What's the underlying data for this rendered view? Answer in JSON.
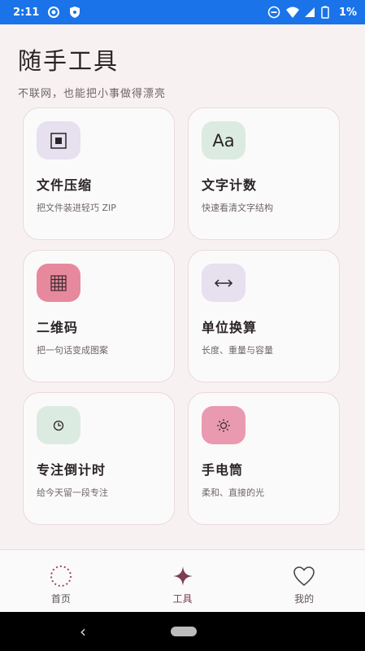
{
  "status_bar": {
    "time": "2:11",
    "battery": "1%"
  },
  "header": {
    "title": "随手工具",
    "subtitle": "不联网，也能把小事做得漂亮"
  },
  "tools": [
    {
      "title": "文件压缩",
      "desc": "把文件装进轻巧 ZIP",
      "icon": "compress-icon",
      "icon_bg": "#e6e0ef",
      "icon_glyph": "▣"
    },
    {
      "title": "文字计数",
      "desc": "快速看清文字结构",
      "icon": "text-icon",
      "icon_bg": "#dcebe2",
      "icon_glyph": "Aa"
    },
    {
      "title": "二维码",
      "desc": "把一句话变成图案",
      "icon": "grid-icon",
      "icon_bg": "#e7899d",
      "icon_glyph": "▦"
    },
    {
      "title": "单位换算",
      "desc": "长度、重量与容量",
      "icon": "arrows-icon",
      "icon_bg": "#e6e0ef",
      "icon_glyph": "↔"
    },
    {
      "title": "专注倒计时",
      "desc": "给今天留一段专注",
      "icon": "clock-icon",
      "icon_bg": "#dcebe2",
      "icon_glyph": "◷"
    },
    {
      "title": "手电筒",
      "desc": "柔和、直接的光",
      "icon": "sun-icon",
      "icon_bg": "#e99ab0",
      "icon_glyph": "☼"
    }
  ],
  "bottom_nav": [
    {
      "label": "首页",
      "icon": "home-ring-icon"
    },
    {
      "label": "工具",
      "icon": "sparkle-icon",
      "active": true
    },
    {
      "label": "我的",
      "icon": "heart-icon"
    }
  ],
  "colors": {
    "accent": "#7a3f51",
    "status_bar": "#1a73e8"
  }
}
